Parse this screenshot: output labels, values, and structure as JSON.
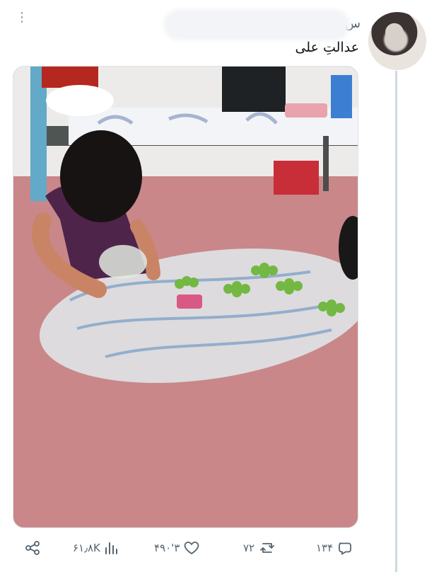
{
  "post": {
    "username_visible": "س",
    "text": "عدالتِ علی",
    "stats": {
      "replies": "۱۳۴",
      "reposts": "۷۲",
      "likes": "۳'۴۹۰",
      "views": "۶۱٫۸K"
    }
  },
  "icons": {
    "more": "more-icon",
    "reply": "reply-icon",
    "repost": "repost-icon",
    "like": "heart-icon",
    "views": "views-icon",
    "share": "share-icon"
  },
  "colors": {
    "muted": "#536471",
    "text": "#0f1419",
    "carpet": "#c98789"
  }
}
